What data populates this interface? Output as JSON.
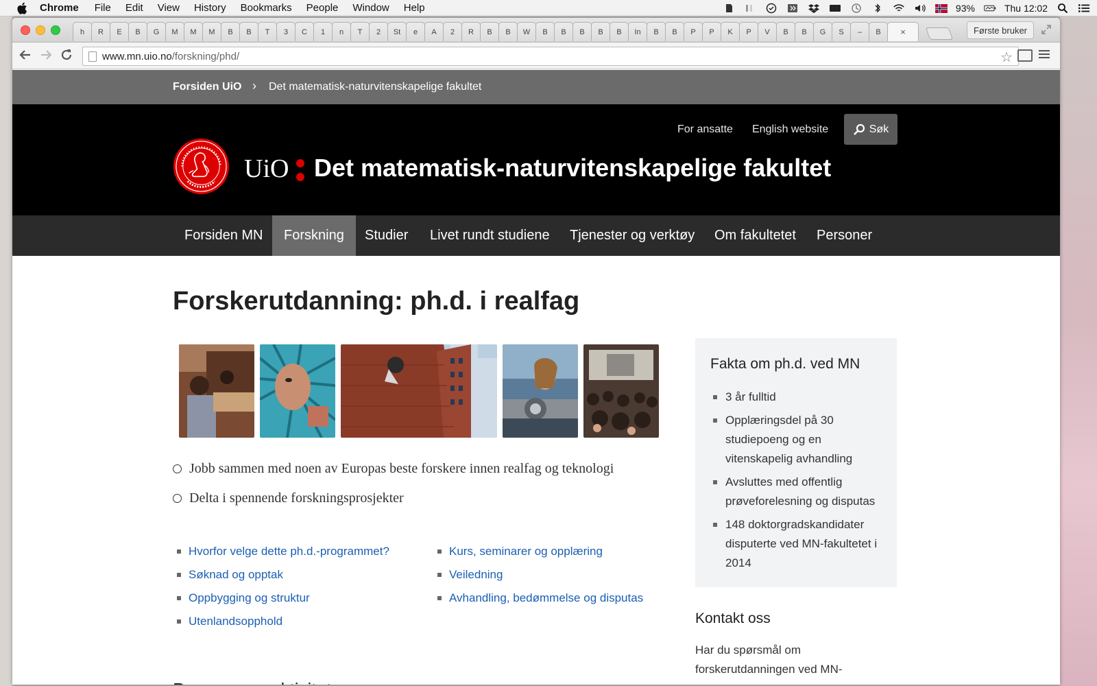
{
  "menubar": {
    "app_name": "Chrome",
    "items": [
      "File",
      "Edit",
      "View",
      "History",
      "Bookmarks",
      "People",
      "Window",
      "Help"
    ],
    "battery": "93%",
    "clock": "Thu 12:02",
    "tray_icons": [
      "evernote-icon",
      "volume-slider-icon",
      "task-check-icon",
      "app-icon",
      "dropbox-icon",
      "keyboard-icon",
      "time-machine-icon",
      "bluetooth-icon",
      "wifi-icon",
      "speaker-icon",
      "norway-flag-icon",
      "battery-icon",
      "spotlight-search-icon",
      "notification-center-icon"
    ]
  },
  "browser": {
    "tabs": [
      "h",
      "R",
      "E",
      "B",
      "G",
      "M",
      "M",
      "M",
      "B",
      "B",
      "T",
      "3",
      "C",
      "1",
      "n",
      "T",
      "2",
      "St",
      "e",
      "A",
      "2",
      "R",
      "B",
      "B",
      "W",
      "B",
      "B",
      "B",
      "B",
      "B",
      "In",
      "B",
      "B",
      "P",
      "P",
      "K",
      "P",
      "V",
      "B",
      "B",
      "G",
      "S",
      "–",
      "B"
    ],
    "active_tab_close": "×",
    "profile_button": "Første bruker",
    "url_host": "www.mn.uio.no",
    "url_path": "/forskning/phd/"
  },
  "site": {
    "breadcrumb_home": "Forsiden UiO",
    "breadcrumb_separator": "›",
    "breadcrumb_current": "Det matematisk-naturvitenskapelige fakultet",
    "link_employees": "For ansatte",
    "link_english": "English website",
    "search_label": "Søk",
    "wordmark": "UiO",
    "faculty_title": "Det matematisk-naturvitenskapelige fakultet",
    "brand_red": "#dd0000",
    "nav": [
      "Forsiden MN",
      "Forskning",
      "Studier",
      "Livet rundt studiene",
      "Tjenester og verktøy",
      "Om fakultetet",
      "Personer"
    ],
    "nav_active": "Forskning"
  },
  "content": {
    "title": "Forskerutdanning: ph.d. i realfag",
    "photos": [
      "students-in-lab-photo",
      "researcher-with-molecule-model-photo",
      "brick-building-photo",
      "researcher-with-equipment-photo",
      "lecture-hall-audience-photo"
    ],
    "highlights": [
      "Jobb sammen med noen av Europas beste forskere innen realfag og teknologi",
      "Delta i spennende forskningsprosjekter"
    ],
    "links_left": [
      "Hvorfor velge dette ph.d.-programmet?",
      "Søknad og opptak",
      "Oppbygging og struktur",
      "Utenlandsopphold"
    ],
    "links_right": [
      "Kurs, seminarer og opplæring",
      "Veiledning",
      "Avhandling, bedømmelse og disputas"
    ],
    "next_heading": "Program og aktivitet"
  },
  "sidebar": {
    "fact_title": "Fakta om ph.d. ved MN",
    "facts": [
      "3 år fulltid",
      "Opplæringsdel på 30 studiepoeng og en vitenskapelig avhandling",
      "Avsluttes med offentlig prøveforelesning og disputas",
      "148 doktorgradskandidater disputerte ved MN-fakultetet i 2014"
    ],
    "contact_title": "Kontakt oss",
    "contact_text": "Har du spørsmål om forskerutdanningen ved MN-"
  }
}
